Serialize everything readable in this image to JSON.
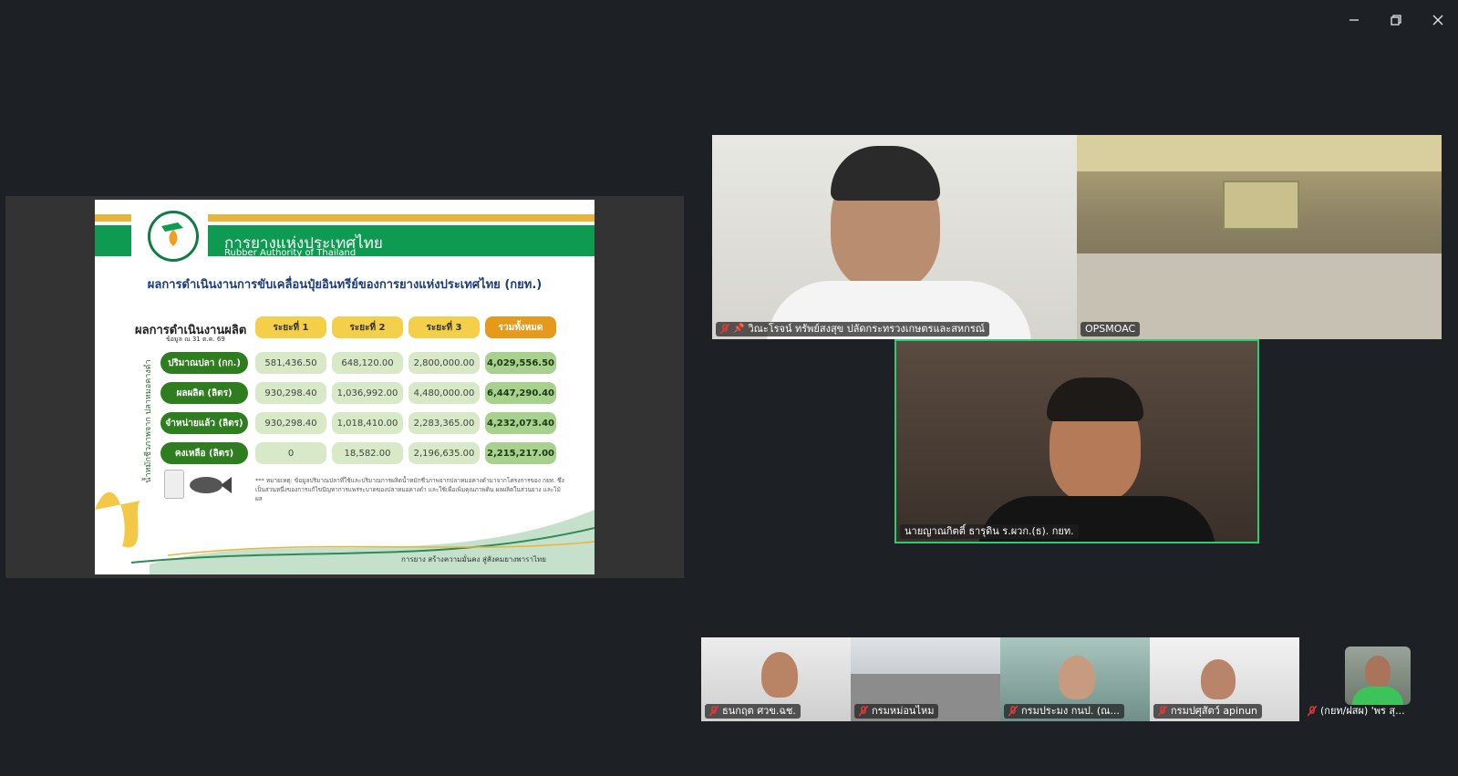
{
  "window_controls": {
    "minimize": "minimize",
    "restore": "restore",
    "close": "close"
  },
  "slide": {
    "org_name_th": "การยางแห่งประเทศไทย",
    "org_name_en": "Rubber Authority of Thailand",
    "title": "ผลการดำเนินงานการขับเคลื่อนปุ๋ยอินทรีย์ของการยางแห่งประเทศไทย (กยท.)",
    "section_title": "ผลการดำเนินงานผลิต",
    "section_subtitle": "ข้อมูล ณ 31 ต.ค. 69",
    "side_label": "น้ำหมักชีวภาพจาก ปลาหมอคางดำ",
    "columns": [
      "ระยะที่ 1",
      "ระยะที่ 2",
      "ระยะที่ 3",
      "รวมทั้งหมด"
    ],
    "rows": [
      {
        "label": "ปริมาณปลา (กก.)",
        "values": [
          "581,436.50",
          "648,120.00",
          "2,800,000.00",
          "4,029,556.50"
        ]
      },
      {
        "label": "ผลผลิต (ลิตร)",
        "values": [
          "930,298.40",
          "1,036,992.00",
          "4,480,000.00",
          "6,447,290.40"
        ]
      },
      {
        "label": "จำหน่ายแล้ว (ลิตร)",
        "values": [
          "930,298.40",
          "1,018,410.00",
          "2,283,365.00",
          "4,232,073.40"
        ]
      },
      {
        "label": "คงเหลือ (ลิตร)",
        "values": [
          "0",
          "18,582.00",
          "2,196,635.00",
          "2,215,217.00"
        ]
      }
    ],
    "note": "*** หมายเหตุ: ข้อมูลปริมาณปลาที่ใช้และปริมาณการผลิตน้ำหมักชีวภาพจากปลาหมอคางดำมาจากโครงการของ กยท. ซึ่งเป็นส่วนหนึ่งของการแก้ไขปัญหาการแพร่ระบาดของปลาหมอคางดำ และใช้เพื่อเพิ่มคุณภาพดิน ผลผลิตในสวนยาง และไม้ผล",
    "footer": "การยาง  สร้างความมั่นคง สู่สังคมยางพาราไทย"
  },
  "participants": [
    {
      "name": "วิณะโรจน์ ทรัพย์สงสุข ปลัดกระทรวงเกษตรและสหกรณ์",
      "muted": true,
      "pinned": true
    },
    {
      "name": "OPSMOAC",
      "muted": false,
      "pinned": false
    },
    {
      "name": "นายญาณกิตติ์ ธารุดิน ร.ผวก.(ธ). กยท.",
      "muted": false,
      "pinned": false,
      "speaking": true
    },
    {
      "name": "ธนกฤต ศวข.ฉช.",
      "muted": true
    },
    {
      "name": "กรมหม่อนไหม",
      "muted": true
    },
    {
      "name": "กรมประมง กนป. (ณ...",
      "muted": true
    },
    {
      "name": "กรมปศุสัตว์ apinun",
      "muted": true
    },
    {
      "name": "(กยท/ฝสผ) 'พร สุ...",
      "muted": true
    }
  ],
  "colors": {
    "background": "#1d2126",
    "speaking_border": "#2ecc71",
    "muted_icon": "#e53935",
    "rubber_green": "#0f9a52",
    "gold": "#e8b43a"
  }
}
